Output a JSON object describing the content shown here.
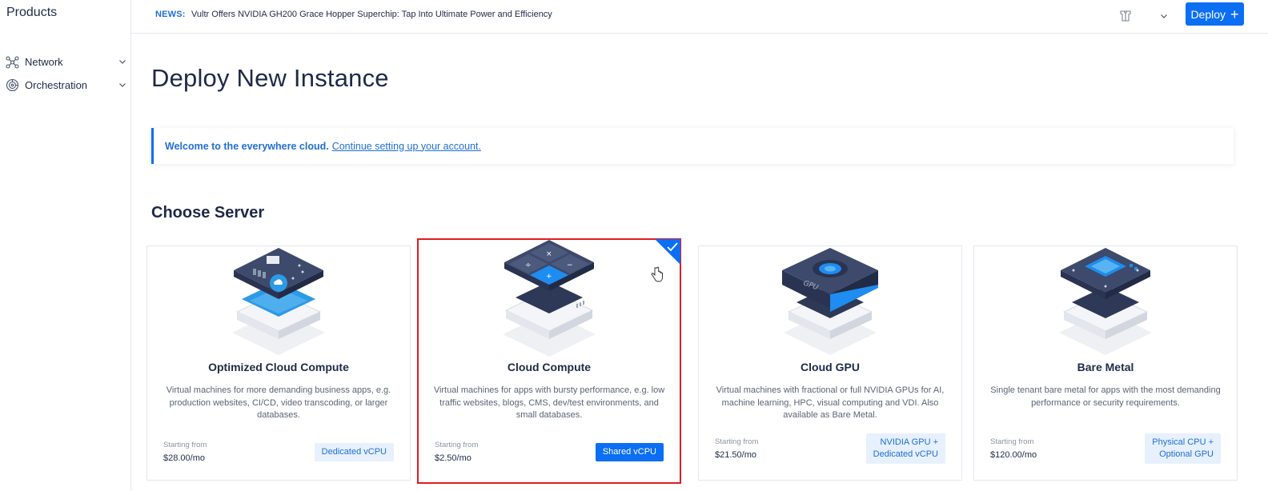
{
  "sidebar": {
    "title": "Products",
    "items": [
      {
        "label": "Network",
        "icon": "network-icon"
      },
      {
        "label": "Orchestration",
        "icon": "orchestration-icon"
      }
    ]
  },
  "topbar": {
    "news_label": "NEWS:",
    "news_text": "Vultr Offers NVIDIA GH200 Grace Hopper Superchip: Tap Into Ultimate Power and Efficiency",
    "deploy_label": "Deploy",
    "deploy_icon": "plus-icon",
    "icons": [
      "uniform-icon",
      "chevron-down-icon"
    ]
  },
  "page": {
    "title": "Deploy New Instance",
    "banner_strong": "Welcome to the everywhere cloud.",
    "banner_link": "Continue setting up your account.",
    "section_title": "Choose Server"
  },
  "cards": [
    {
      "title": "Optimized Cloud Compute",
      "desc": "Virtual machines for more demanding business apps, e.g. production websites, CI/CD, video transcoding, or larger databases.",
      "start_label": "Starting from",
      "price": "$28.00/mo",
      "tag": "Dedicated vCPU",
      "selected": false
    },
    {
      "title": "Cloud Compute",
      "desc": "Virtual machines for apps with bursty performance, e.g. low traffic websites, blogs, CMS, dev/test environments, and small databases.",
      "start_label": "Starting from",
      "price": "$2.50/mo",
      "tag": "Shared vCPU",
      "selected": true
    },
    {
      "title": "Cloud GPU",
      "desc": "Virtual machines with fractional or full NVIDIA GPUs for AI, machine learning, HPC, visual computing and VDI. Also available as Bare Metal.",
      "start_label": "Starting from",
      "price": "$21.50/mo",
      "tag_line1": "NVIDIA GPU +",
      "tag_line2": "Dedicated vCPU",
      "gpu_label": "GPU",
      "selected": false
    },
    {
      "title": "Bare Metal",
      "desc": "Single tenant bare metal for apps with the most demanding performance or security requirements.",
      "start_label": "Starting from",
      "price": "$120.00/mo",
      "tag_line1": "Physical CPU +",
      "tag_line2": "Optional GPU",
      "selected": false
    }
  ],
  "colors": {
    "accent": "#0b6ef3",
    "selection_border": "#e11b22",
    "text": "#1d2a47"
  }
}
